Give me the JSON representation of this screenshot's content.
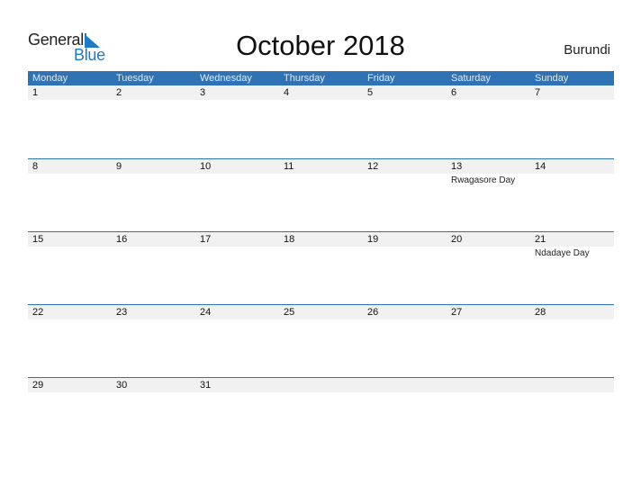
{
  "logo": {
    "word1": "General",
    "word2": "Blue"
  },
  "header": {
    "title": "October 2018",
    "country": "Burundi"
  },
  "weekdays": [
    "Monday",
    "Tuesday",
    "Wednesday",
    "Thursday",
    "Friday",
    "Saturday",
    "Sunday"
  ],
  "weeks": [
    {
      "days": [
        "1",
        "2",
        "3",
        "4",
        "5",
        "6",
        "7"
      ],
      "events": [
        "",
        "",
        "",
        "",
        "",
        "",
        ""
      ]
    },
    {
      "days": [
        "8",
        "9",
        "10",
        "11",
        "12",
        "13",
        "14"
      ],
      "events": [
        "",
        "",
        "",
        "",
        "",
        "Rwagasore Day",
        ""
      ]
    },
    {
      "days": [
        "15",
        "16",
        "17",
        "18",
        "19",
        "20",
        "21"
      ],
      "events": [
        "",
        "",
        "",
        "",
        "",
        "",
        "Ndadaye Day"
      ]
    },
    {
      "days": [
        "22",
        "23",
        "24",
        "25",
        "26",
        "27",
        "28"
      ],
      "events": [
        "",
        "",
        "",
        "",
        "",
        "",
        ""
      ]
    },
    {
      "days": [
        "29",
        "30",
        "31",
        "",
        "",
        "",
        ""
      ],
      "events": [
        "",
        "",
        "",
        "",
        "",
        "",
        ""
      ]
    }
  ],
  "colors": {
    "accent": "#2f73b5",
    "logo_blue": "#1f7ac6",
    "date_strip": "#f1f1f1"
  }
}
